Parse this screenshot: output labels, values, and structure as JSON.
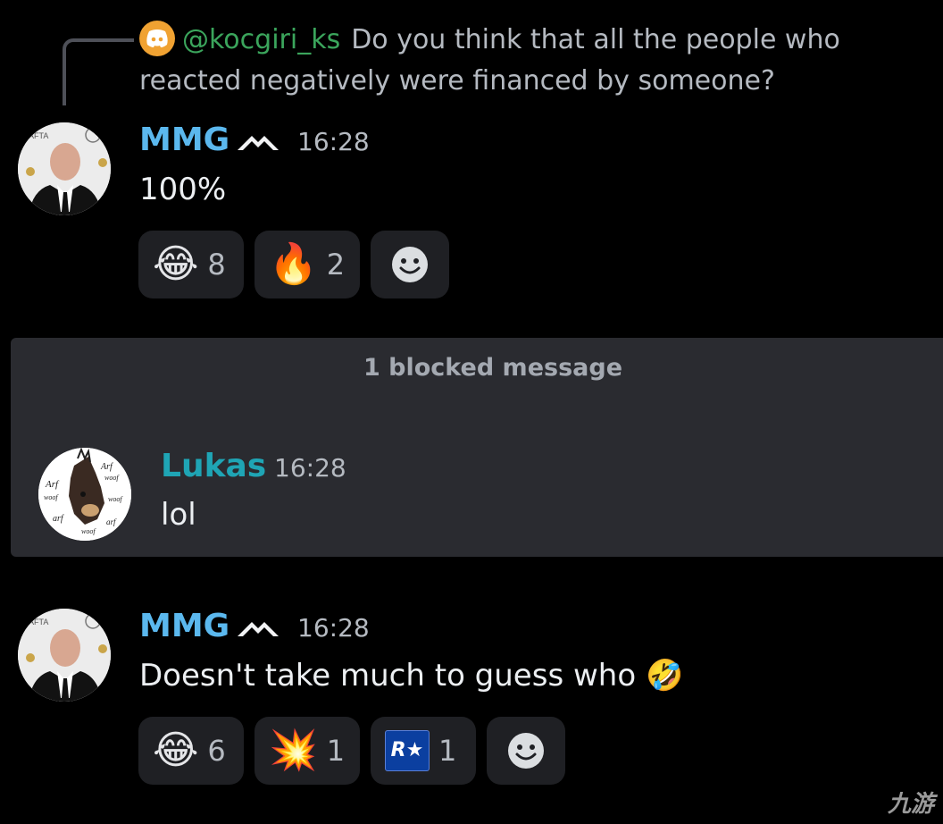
{
  "reply": {
    "author": "@kocgiri_ks",
    "text": "Do you think that all the people who reacted negatively were financed by someone?",
    "icon": "discord-icon"
  },
  "messages": [
    {
      "username": "MMG",
      "username_color": "#5bb8ee",
      "time": "16:28",
      "text": "100%",
      "reactions": [
        {
          "emoji": "😂",
          "count": "8"
        },
        {
          "emoji": "🔥",
          "count": "2"
        }
      ]
    },
    {
      "username": "Lukas",
      "username_color": "#1fa5b5",
      "time": "16:28",
      "text": "lol"
    },
    {
      "username": "MMG",
      "username_color": "#5bb8ee",
      "time": "16:28",
      "text": "Doesn't take much to guess who",
      "text_emoji": "🤣",
      "reactions": [
        {
          "emoji": "😂",
          "count": "6"
        },
        {
          "emoji": "💥",
          "count": "1"
        },
        {
          "emoji": "R★",
          "count": "1"
        }
      ]
    }
  ],
  "blocked": {
    "label": "1 blocked message"
  },
  "avatar_text": [
    "woof",
    "Arf",
    "Arf",
    "woof",
    "Arf",
    "woof",
    "Arf",
    "woof",
    "woof",
    "woof",
    "Arf"
  ],
  "watermark": "九游"
}
